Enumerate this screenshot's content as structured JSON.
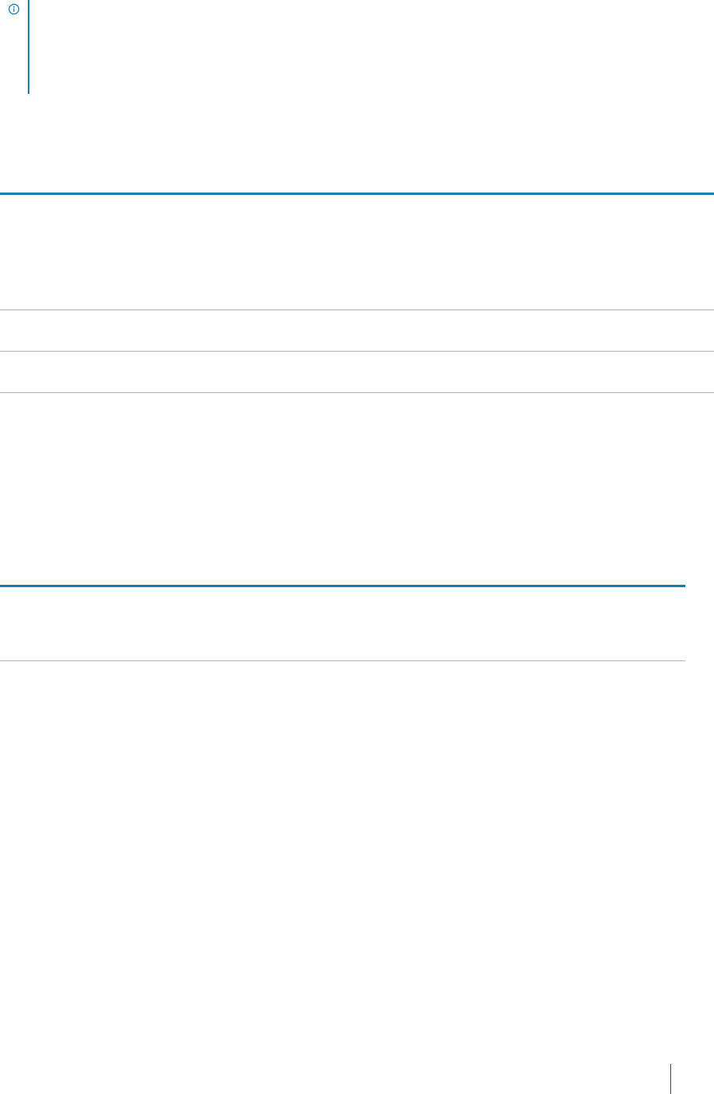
{
  "colors": {
    "accent": "#0076ce",
    "table_header_rule": "#1b7bb5",
    "row_rule": "#b5b5b5",
    "footer_rule": "#4a4a4a"
  },
  "note": {
    "icon": "info-circle-icon",
    "text": ""
  },
  "tables": [
    {
      "rows": 3
    },
    {
      "rows": 1
    }
  ],
  "footer": {
    "page_label": ""
  }
}
